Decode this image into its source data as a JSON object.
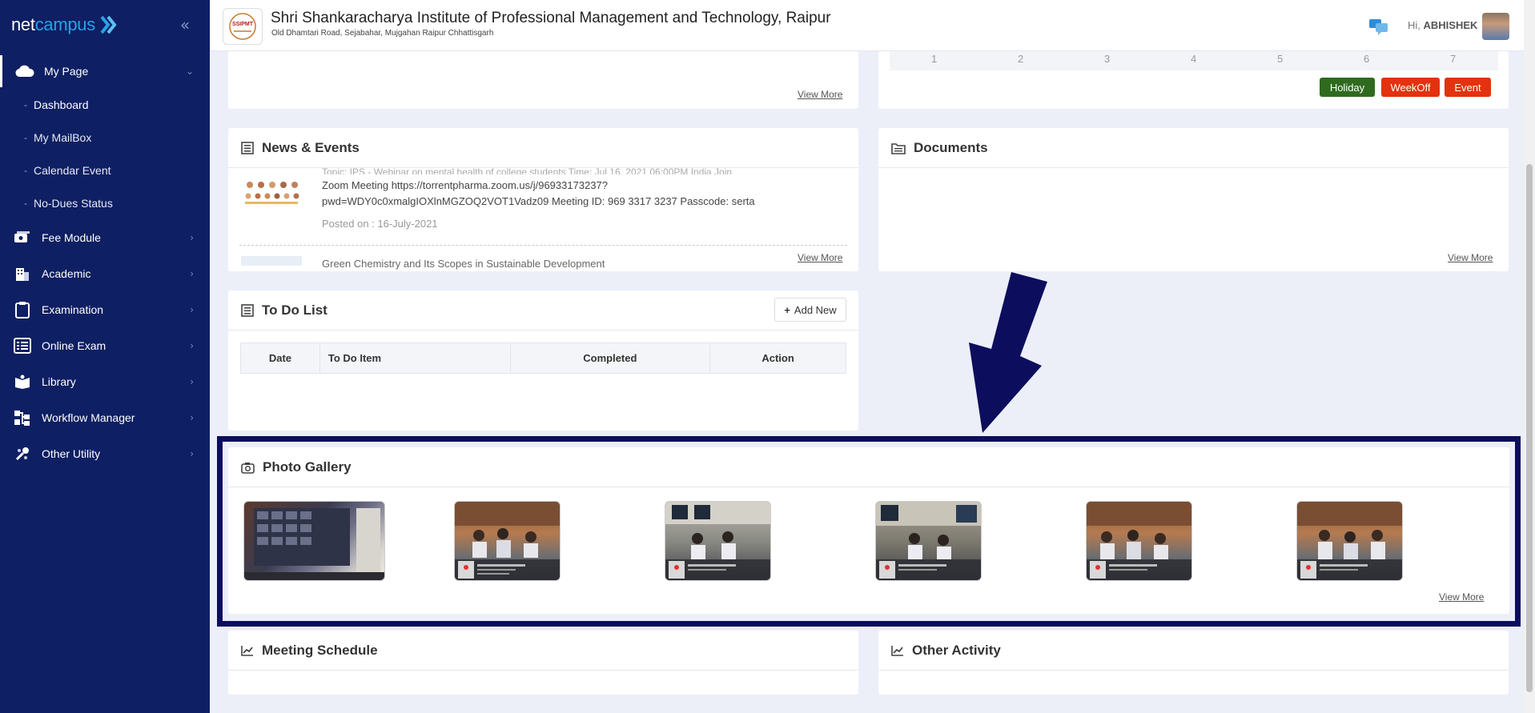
{
  "app": {
    "brand_prefix": "net",
    "brand_suffix": "campus"
  },
  "sidebar": {
    "items": [
      {
        "label": "My Page",
        "icon": "cloud-icon"
      },
      {
        "label": "Fee Module",
        "icon": "money-icon"
      },
      {
        "label": "Academic",
        "icon": "building-icon"
      },
      {
        "label": "Examination",
        "icon": "clipboard-icon"
      },
      {
        "label": "Online Exam",
        "icon": "list-icon"
      },
      {
        "label": "Library",
        "icon": "book-icon"
      },
      {
        "label": "Workflow Manager",
        "icon": "sitemap-icon"
      },
      {
        "label": "Other Utility",
        "icon": "tools-icon"
      }
    ],
    "submenu": [
      {
        "label": "Dashboard"
      },
      {
        "label": "My MailBox"
      },
      {
        "label": "Calendar Event"
      },
      {
        "label": "No-Dues Status"
      }
    ]
  },
  "header": {
    "institute": "Shri Shankaracharya Institute of Professional Management and Technology, Raipur",
    "address": "Old Dhamtari Road, Sejabahar, Mujgahan Raipur Chhattisgarh",
    "logo_text": "SSIPMT",
    "greeting": "Hi,",
    "user": "ABHISHEK"
  },
  "top_left_card": {
    "view_more": "View More"
  },
  "calendar": {
    "days": [
      "1",
      "2",
      "3",
      "4",
      "5",
      "6",
      "7"
    ],
    "legend": [
      {
        "label": "Holiday",
        "color": "#2e6b1f"
      },
      {
        "label": "WeekOff",
        "color": "#e4310f"
      },
      {
        "label": "Event",
        "color": "#e4310f"
      }
    ]
  },
  "news": {
    "title": "News & Events",
    "item1_top": "Topic: IPS - Webinar on mental health of college students Time: Jul 16, 2021 06:00PM India Join",
    "item1_line2": "Zoom Meeting https://torrentpharma.zoom.us/j/96933173237?",
    "item1_line3": "pwd=WDY0c0xmalgIOXlnMGZOQ2VOT1Vadz09 Meeting ID: 969 3317 3237 Passcode: serta",
    "item1_posted": "Posted on : 16-July-2021",
    "item2_title": "Green Chemistry and Its Scopes in Sustainable Development",
    "view_more": "View More"
  },
  "documents": {
    "title": "Documents",
    "view_more": "View More"
  },
  "todo": {
    "title": "To Do List",
    "add_new": "Add New",
    "columns": [
      "Date",
      "To Do Item",
      "Completed",
      "Action"
    ]
  },
  "gallery": {
    "title": "Photo Gallery",
    "view_more": "View More"
  },
  "meeting": {
    "title": "Meeting Schedule"
  },
  "activity": {
    "title": "Other Activity"
  },
  "colors": {
    "sidebar": "#0e1f63",
    "highlight": "#0c0d5c",
    "background": "#eceff8"
  }
}
